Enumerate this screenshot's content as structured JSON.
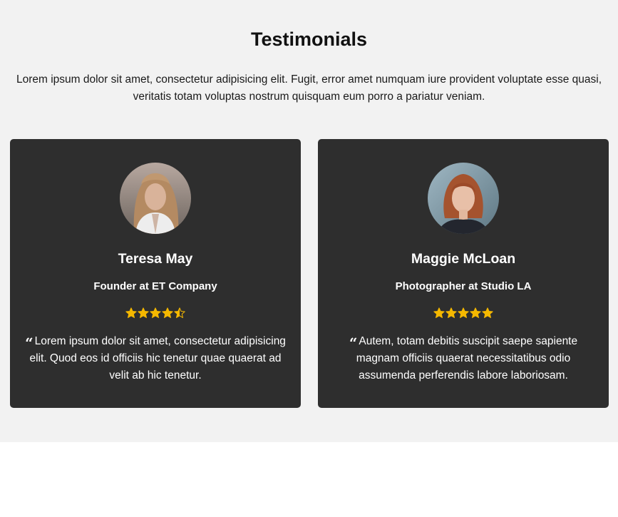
{
  "section": {
    "title": "Testimonials",
    "intro": "Lorem ipsum dolor sit amet, consectetur adipisicing elit. Fugit, error amet numquam iure provident voluptate esse quasi, veritatis totam voluptas nostrum quisquam eum porro a pariatur veniam."
  },
  "colors": {
    "section_bg": "#f2f2f2",
    "card_bg": "#2e2e2e",
    "star": "#f5b800",
    "text_light": "#ffffff"
  },
  "testimonials": [
    {
      "name": "Teresa May",
      "role": "Founder at ET Company",
      "rating": 4.5,
      "quote_icon": "quote-left-icon",
      "quote_mark": "“",
      "quote": "Lorem ipsum dolor sit amet, consectetur adipisicing elit. Quod eos id officiis hic tenetur quae quaerat ad velit ab hic tenetur."
    },
    {
      "name": "Maggie McLoan",
      "role": "Photographer at Studio LA",
      "rating": 5,
      "quote_icon": "quote-left-icon",
      "quote_mark": "“",
      "quote": "Autem, totam debitis suscipit saepe sapiente magnam officiis quaerat necessitatibus odio assumenda perferendis labore laboriosam."
    }
  ]
}
